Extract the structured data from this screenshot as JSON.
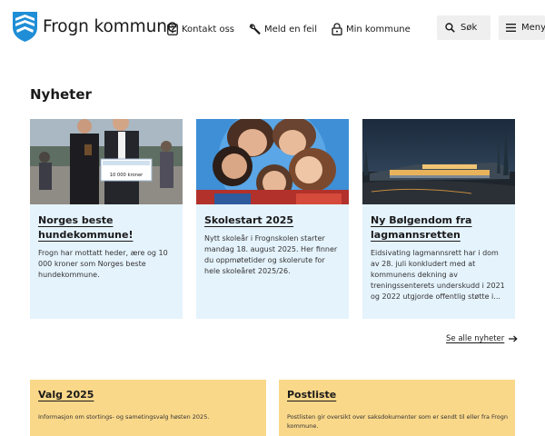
{
  "header": {
    "brand": "Frogn kommune",
    "nav": {
      "kontakt": "Kontakt oss",
      "meld": "Meld en feil",
      "min": "Min kommune"
    },
    "search_label": "Søk",
    "menu_label": "Meny"
  },
  "news": {
    "title": "Nyheter",
    "cards": [
      {
        "title": "Norges beste hundekommune!",
        "text": "Frogn har mottatt heder, ære og 10 000 kroner som Norges beste hundekommune.",
        "image_sign": "10 000 kroner"
      },
      {
        "title": "Skolestart 2025",
        "text": "Nytt skoleår i Frognskolen starter mandag 18. august 2025. Her finner du oppmøtetider og skolerute for hele skoleåret 2025/26."
      },
      {
        "title": "Ny Bølgendom fra lagmannsretten",
        "text": "Eidsivating lagmannsrett har i dom av 28. juli konkludert med at kommunens dekning av treningssenterets underskudd i 2021 og 2022 utgjorde offentlig støtte i..."
      }
    ],
    "see_all": "Se alle nyheter"
  },
  "boxes": [
    {
      "title": "Valg 2025",
      "text": "Informasjon om stortings- og sametingsvalg høsten 2025."
    },
    {
      "title": "Postliste",
      "text": "Postlisten gir oversikt over saksdokumenter som er sendt til eller fra Frogn kommune."
    }
  ],
  "colors": {
    "card_bg": "#e5f3fc",
    "box_bg": "#fad88a",
    "logo_blue": "#1f8ed6",
    "button_bg": "#efefef"
  },
  "icons": {
    "logo": "coat-of-arms-icon",
    "kontakt": "question-box-icon",
    "meld": "wrench-icon",
    "min": "lock-icon",
    "search": "search-icon",
    "menu": "hamburger-icon",
    "see_all": "arrow-right-icon"
  }
}
